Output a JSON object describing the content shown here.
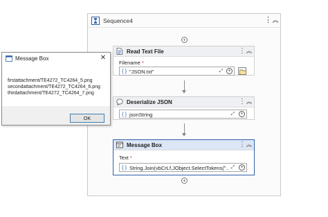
{
  "sequence": {
    "title": "Sequence4"
  },
  "read_text_file": {
    "title": "Read Text File",
    "field_label": "Filename",
    "field_value": "\"JSON.txt\"",
    "brace": "{ }"
  },
  "deserialize_json": {
    "title": "Deserialize JSON",
    "field_value": "jsonString",
    "brace": "{ }"
  },
  "message_box_activity": {
    "title": "Message Box",
    "field_label": "Text",
    "field_value": "String.Join(vbCrLf,JObject.SelectTokens(\"..da",
    "brace": "{ }"
  },
  "required_mark": "*",
  "dialog": {
    "title": "Message Box",
    "lines": [
      "firstattachment/TE4272_TC4264_5.png",
      "secondattachment/TE4272_TC4264_6.png",
      "thirdattachment/TE4272_TC4264_7.png"
    ],
    "ok_label": "OK"
  },
  "icons": {
    "sequence": "sequence-icon",
    "read_text_file": "document-read-icon",
    "deserialize": "json-bubble-icon",
    "message_box": "message-box-icon",
    "overflow": "more-vertical-icon",
    "collapse": "collapse-chevron-icon",
    "add": "plus-circle-icon",
    "expand": "expand-arrows-icon",
    "folder": "folder-icon",
    "close": "close-icon"
  },
  "colors": {
    "selection_border": "#2f5ea8",
    "required": "#c0392b",
    "ok_border": "#3c7fb1"
  }
}
